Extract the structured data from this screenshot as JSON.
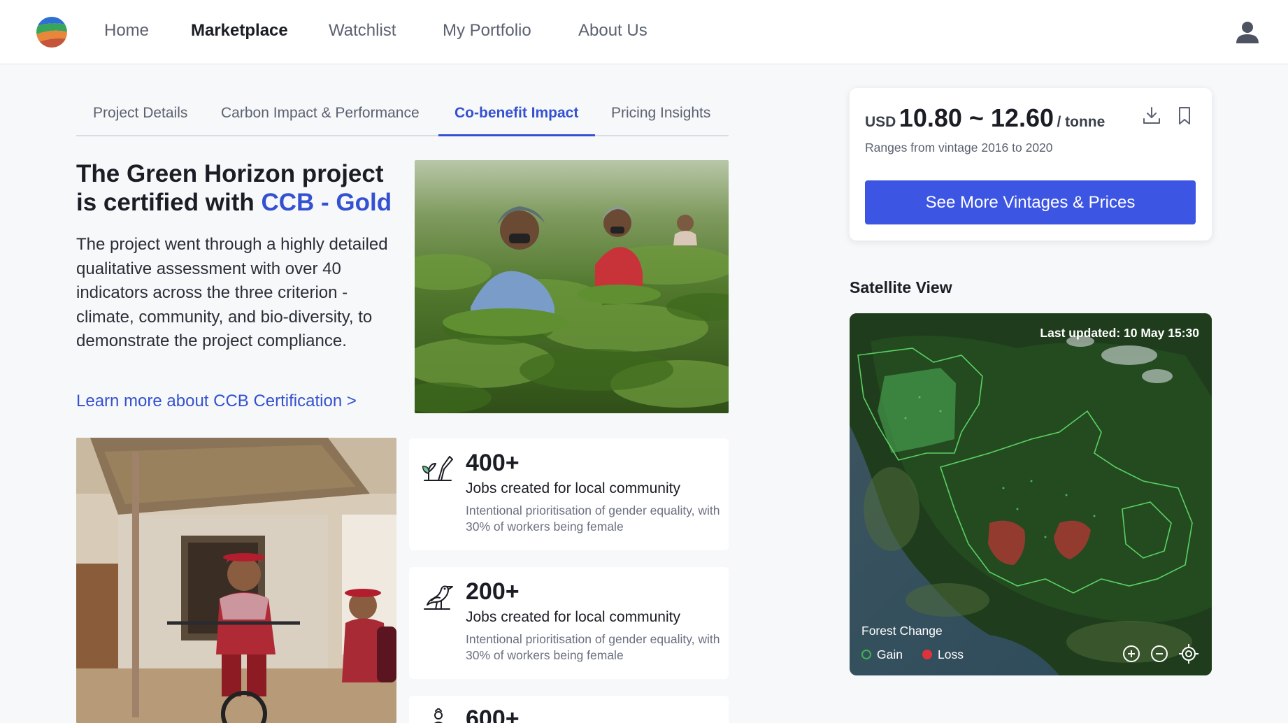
{
  "nav": {
    "items": [
      {
        "label": "Home",
        "active": false
      },
      {
        "label": "Marketplace",
        "active": true
      },
      {
        "label": "Watchlist",
        "active": false
      },
      {
        "label": "My Portfolio",
        "active": false
      },
      {
        "label": "About Us",
        "active": false
      }
    ],
    "user_icon": "user-icon"
  },
  "tabs": [
    {
      "label": "Project Details",
      "active": false
    },
    {
      "label": "Carbon Impact & Performance",
      "active": false
    },
    {
      "label": "Co-benefit Impact",
      "active": true
    },
    {
      "label": "Pricing Insights",
      "active": false
    }
  ],
  "certification": {
    "title_line1": "The Green Horizon project",
    "title_line2_prefix": "is certified with ",
    "title_accent": "CCB - Gold",
    "description": "The project went through a highly detailed qualitative assessment with over 40 indicators across the three criterion - climate, community, and bio-diversity, to demonstrate the project compliance.",
    "link": "Learn more about CCB Certification >"
  },
  "stats": [
    {
      "icon": "plant-hand-icon",
      "value": "400+",
      "title": "Jobs created for local community",
      "description": "Intentional prioritisation of gender equality, with 30% of workers being female"
    },
    {
      "icon": "bird-icon",
      "value": "200+",
      "title": "Jobs created for local community",
      "description": "Intentional prioritisation of gender equality, with 30% of workers being female"
    },
    {
      "icon": "community-icon",
      "value": "600+",
      "title": "",
      "description": ""
    }
  ],
  "pricing": {
    "currency": "USD",
    "range": "10.80 ~ 12.60",
    "unit": "/ tonne",
    "subtitle": "Ranges from vintage 2016 to 2020",
    "cta": "See More Vintages & Prices",
    "download_icon": "download-icon",
    "bookmark_icon": "bookmark-icon"
  },
  "satellite": {
    "title": "Satellite View",
    "last_updated": "Last updated: 10 May 15:30",
    "legend_title": "Forest Change",
    "legend": [
      {
        "label": "Gain",
        "color": "#3fb34f"
      },
      {
        "label": "Loss",
        "color": "#e0323c"
      }
    ],
    "controls": [
      "zoom-in-icon",
      "zoom-out-icon",
      "locate-icon"
    ]
  },
  "colors": {
    "accent": "#3451d1",
    "cta": "#3d55e3",
    "gain": "#3fb34f",
    "loss": "#e0323c"
  }
}
